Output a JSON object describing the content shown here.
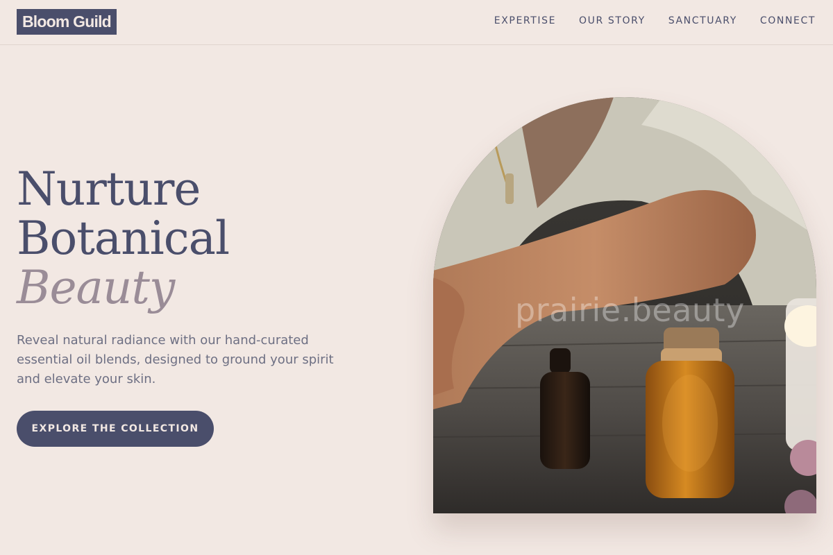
{
  "brand": {
    "name": "Bloom Guild"
  },
  "nav": {
    "items": [
      {
        "label": "EXPERTISE"
      },
      {
        "label": "OUR STORY"
      },
      {
        "label": "SANCTUARY"
      },
      {
        "label": "CONNECT"
      }
    ]
  },
  "hero": {
    "title_line1": "Nurture",
    "title_line2": "Botanical",
    "title_accent": "Beauty",
    "subtitle": "Reveal natural radiance with our hand-curated essential oil blends, designed to ground your spirit and elevate your skin.",
    "cta_label": "EXPLORE THE COLLECTION",
    "image_watermark": "prairie.beauty"
  },
  "colors": {
    "background": "#f2e8e3",
    "primary": "#4a4e6b",
    "accent": "#9a8c97"
  }
}
